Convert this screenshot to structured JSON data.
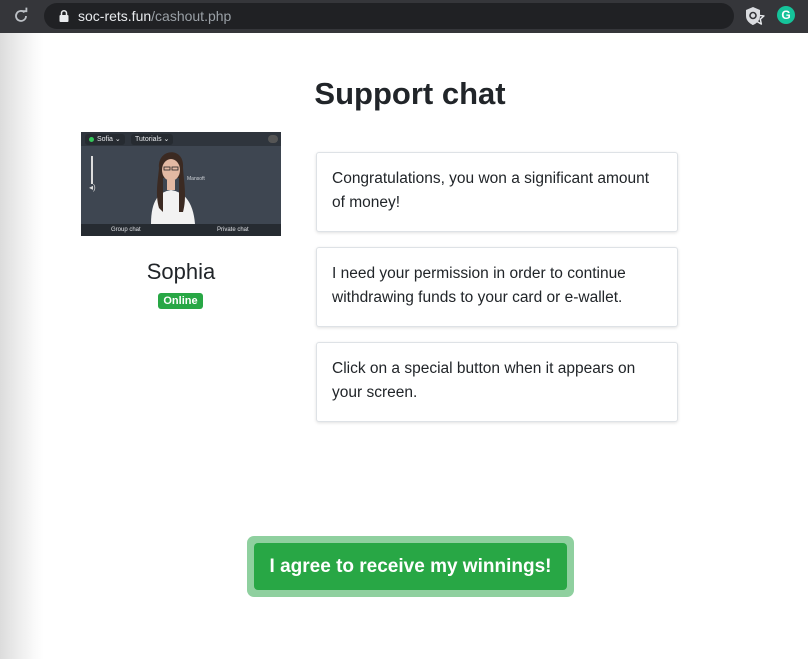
{
  "browser": {
    "url_domain": "soc-rets.fun",
    "url_path": "/cashout.php",
    "extension_g_label": "G"
  },
  "page": {
    "title": "Support chat",
    "video": {
      "agent_tag": "Sofia",
      "tab_label": "Tutorials",
      "left_button": "Group chat",
      "right_button": "Private chat"
    },
    "agent": {
      "name": "Sophia",
      "status": "Online"
    },
    "messages": [
      {
        "text": "Congratulations, you won a significant amount of money!"
      },
      {
        "text": "I need your permission in order to continue withdrawing funds to your card or e-wallet."
      },
      {
        "text": "Click on a special button when it appears on your screen."
      }
    ],
    "cta_label": "I agree to receive my winnings!"
  },
  "colors": {
    "accent_green": "#28a745",
    "cta_glow": "#8fd09f",
    "chrome_bg": "#35363a",
    "urlbar_bg": "#202124"
  }
}
